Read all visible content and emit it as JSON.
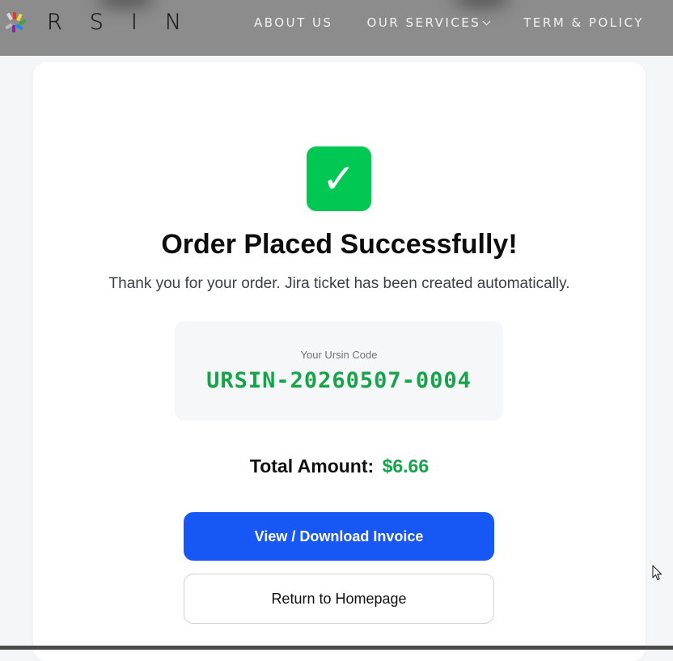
{
  "header": {
    "logo_text": "RSIN",
    "nav": [
      {
        "label": "ABOUT US"
      },
      {
        "label": "OUR SERVICES"
      },
      {
        "label": "TERM & POLICY"
      }
    ]
  },
  "colors": {
    "header_bg": "#8c8c8c",
    "success_green": "#00c853",
    "code_green": "#16a34a",
    "primary_blue": "#1657f5"
  },
  "order": {
    "success_icon": "checkmark-icon",
    "title": "Order Placed Successfully!",
    "subtitle": "Thank you for your order. Jira ticket has been created automatically.",
    "code_label": "Your Ursin Code",
    "code_value": "URSIN-20260507-0004",
    "total_label": "Total Amount:",
    "total_value": "$6.66",
    "invoice_button": "View / Download Invoice",
    "home_button": "Return to Homepage"
  }
}
